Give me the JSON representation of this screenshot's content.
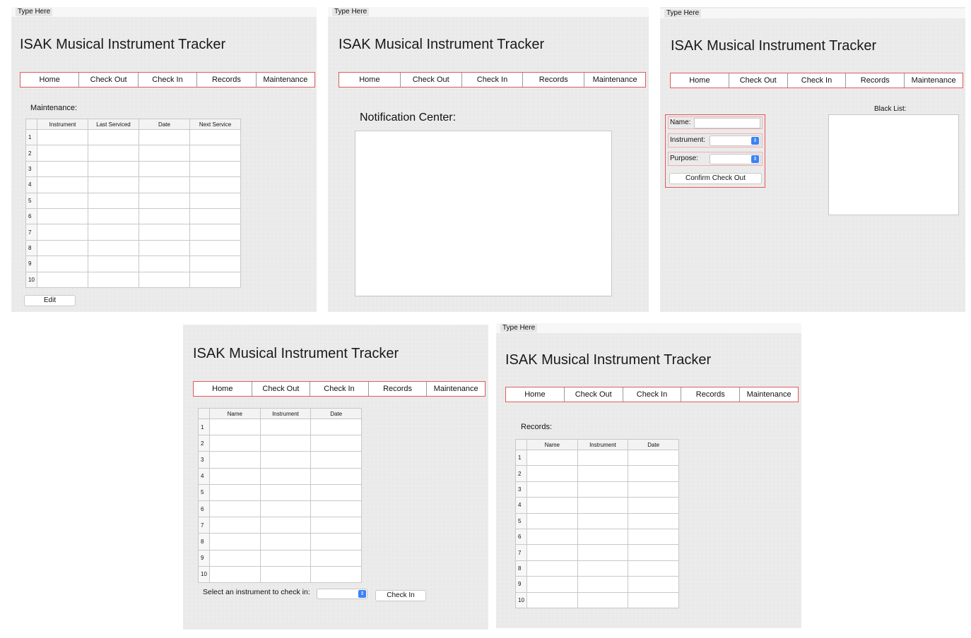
{
  "menu_label": "Type Here",
  "app_title": "ISAK Musical Instrument Tracker",
  "nav": [
    "Home",
    "Check Out",
    "Check In",
    "Records",
    "Maintenance"
  ],
  "row_numbers": [
    "1",
    "2",
    "3",
    "4",
    "5",
    "6",
    "7",
    "8",
    "9",
    "10"
  ],
  "maintenance": {
    "label": "Maintenance:",
    "columns": [
      "Instrument",
      "Last Serviced",
      "Date",
      "Next Service"
    ],
    "edit_button": "Edit"
  },
  "home": {
    "notification_label": "Notification Center:"
  },
  "checkout": {
    "name_label": "Name:",
    "instrument_label": "Instrument:",
    "purpose_label": "Purpose:",
    "confirm_button": "Confirm Check Out",
    "blacklist_label": "Black List:"
  },
  "checkin": {
    "columns": [
      "Name",
      "Instrument",
      "Date"
    ],
    "select_label": "Select an instrument to check in:",
    "checkin_button": "Check In"
  },
  "records": {
    "label": "Records:",
    "columns": [
      "Name",
      "Instrument",
      "Date"
    ]
  },
  "colors": {
    "nav_border": "#e05a5a",
    "select_arrow": "#3b82f6",
    "panel_bg": "#ebebeb"
  }
}
